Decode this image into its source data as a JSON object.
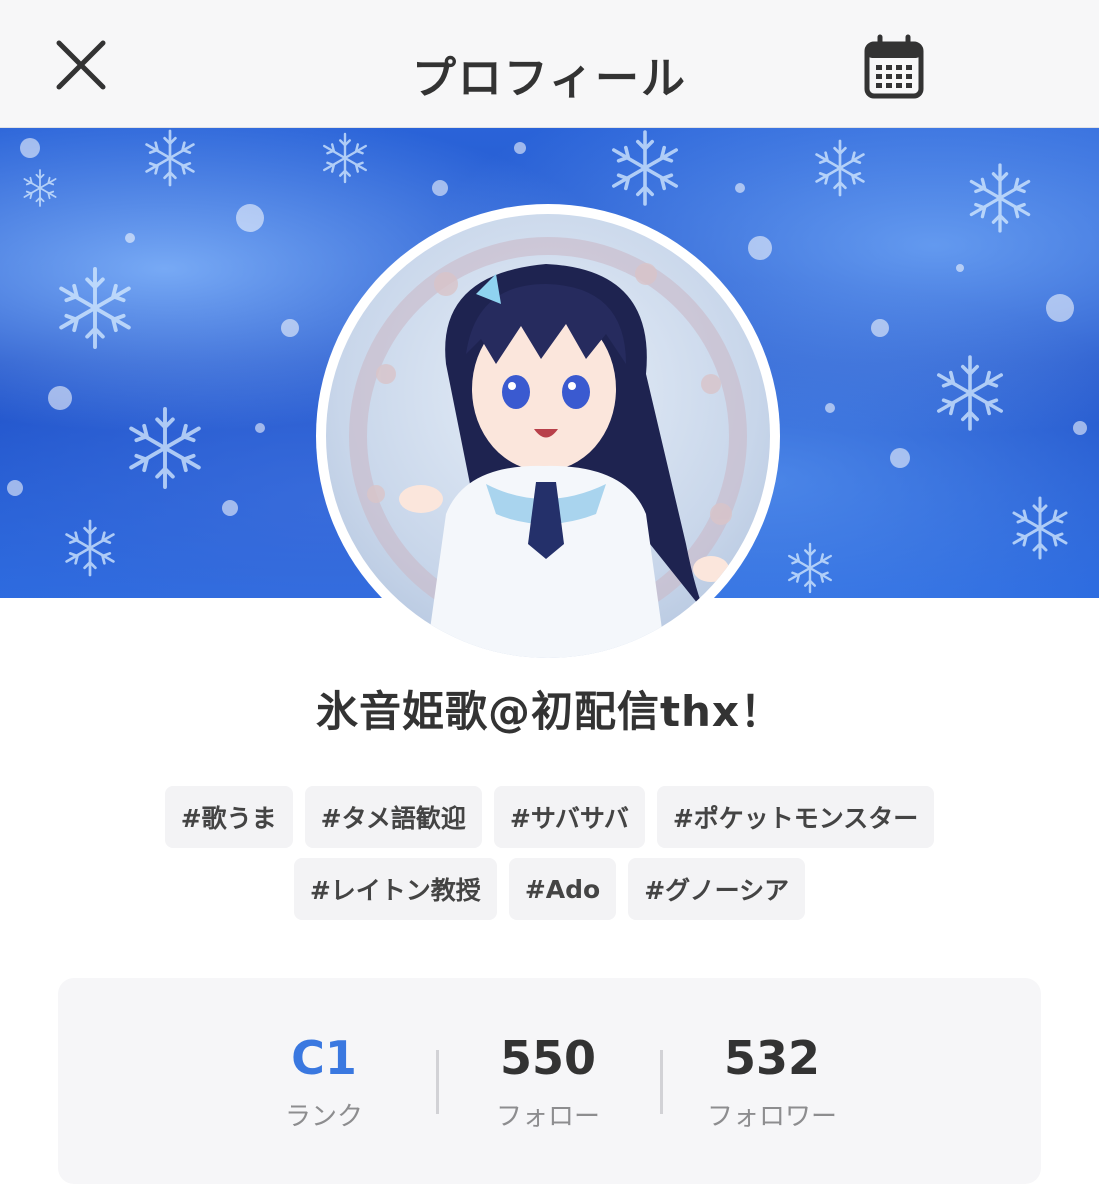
{
  "header": {
    "title": "プロフィール",
    "close_icon": "close-icon",
    "calendar_icon": "calendar-icon"
  },
  "profile": {
    "name": "氷音姫歌@初配信thx！"
  },
  "tags": {
    "row1": [
      "#歌うま",
      "#タメ語歓迎",
      "#サバサバ",
      "#ポケットモンスター"
    ],
    "row2": [
      "#レイトン教授",
      "#Ado",
      "#グノーシア"
    ]
  },
  "stats": {
    "rank": {
      "value": "C1",
      "label": "ランク"
    },
    "follow": {
      "value": "550",
      "label": "フォロー"
    },
    "follower": {
      "value": "532",
      "label": "フォロワー"
    }
  },
  "colors": {
    "rank_accent": "#3a78e0",
    "banner_blue": "#1f4fc6"
  }
}
